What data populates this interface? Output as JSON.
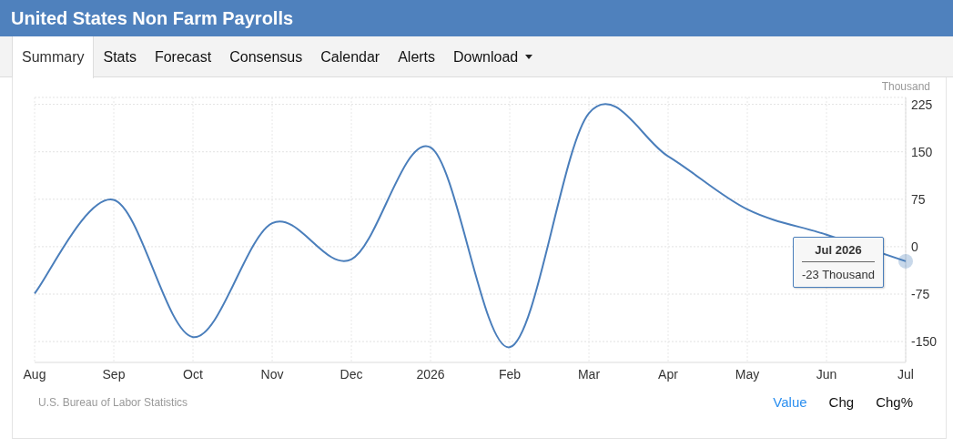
{
  "title": "United States Non Farm Payrolls",
  "tabs": [
    {
      "label": "Summary",
      "selected": true
    },
    {
      "label": "Stats",
      "selected": false
    },
    {
      "label": "Forecast",
      "selected": false
    },
    {
      "label": "Consensus",
      "selected": false
    },
    {
      "label": "Calendar",
      "selected": false
    },
    {
      "label": "Alerts",
      "selected": false
    },
    {
      "label": "Download",
      "selected": false,
      "kind": "dropdown"
    }
  ],
  "chart": {
    "chart_data": {
      "type": "line",
      "ylabel": "Thousand",
      "categories": [
        "Aug",
        "Sep",
        "Oct",
        "Nov",
        "Dec",
        "2026",
        "Feb",
        "Mar",
        "Apr",
        "May",
        "Jun",
        "Jul"
      ],
      "grid": true,
      "series": [
        {
          "color": "#4a7ebb",
          "values": [
            -74,
            74,
            -143,
            37,
            -20,
            157,
            -159,
            211,
            143,
            59,
            19,
            -23
          ]
        }
      ],
      "ylim": [
        -183,
        236
      ],
      "yticks": [
        -150,
        -75,
        0,
        75,
        150,
        225
      ]
    },
    "tooltip": {
      "title": "Jul 2026",
      "value": "-23 Thousand"
    }
  },
  "source": "U.S. Bureau of Labor Statistics",
  "modes": [
    {
      "label": "Value",
      "selected": true
    },
    {
      "label": "Chg",
      "selected": false
    },
    {
      "label": "Chg%",
      "selected": false
    }
  ]
}
